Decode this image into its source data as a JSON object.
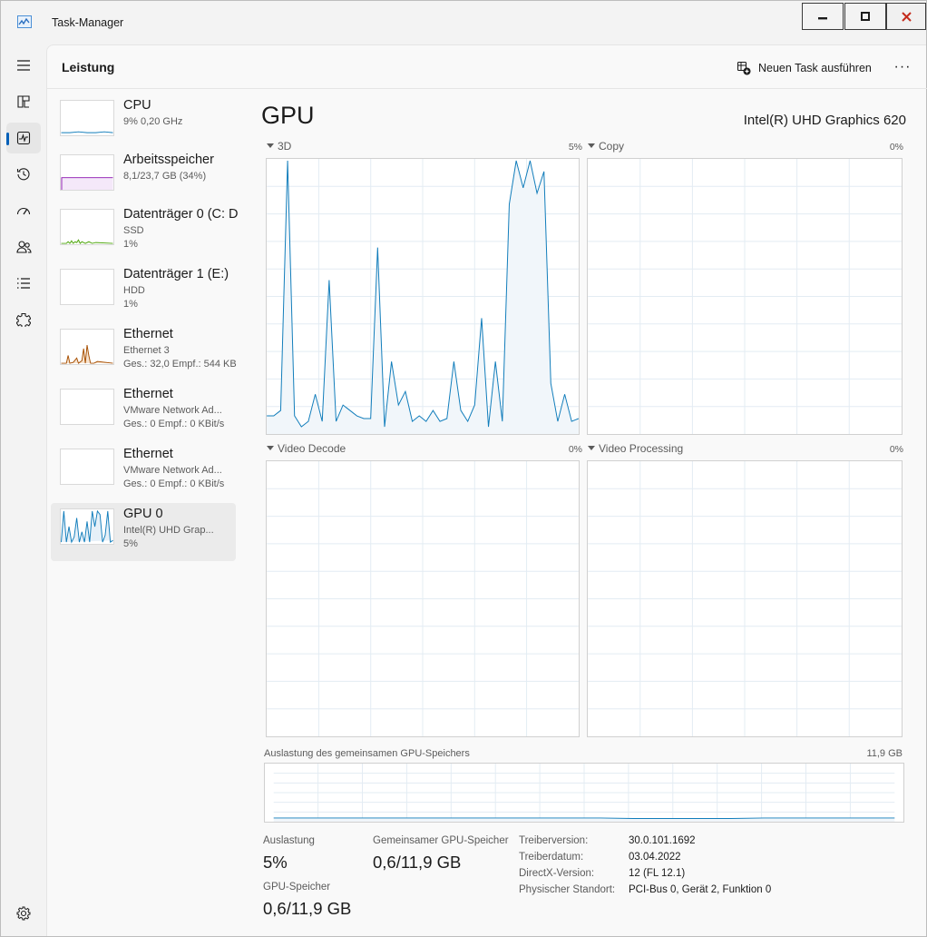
{
  "window": {
    "title": "Task-Manager"
  },
  "toolbar": {
    "page_title": "Leistung",
    "run_task_label": "Neuen Task ausführen",
    "more_label": "···"
  },
  "nav": {
    "items": [
      {
        "icon": "hamburger-menu-icon"
      },
      {
        "icon": "processes-icon"
      },
      {
        "icon": "performance-icon",
        "active": true
      },
      {
        "icon": "app-history-icon"
      },
      {
        "icon": "startup-apps-icon"
      },
      {
        "icon": "users-icon"
      },
      {
        "icon": "details-icon"
      },
      {
        "icon": "services-icon"
      }
    ],
    "settings_icon": "settings-gear-icon"
  },
  "resources": [
    {
      "name": "CPU",
      "line1": "9% 0,20 GHz",
      "line2": "",
      "color": "#117dbb"
    },
    {
      "name": "Arbeitsspeicher",
      "line1": "8,1/23,7 GB (34%)",
      "line2": "",
      "color": "#8b12ae"
    },
    {
      "name": "Datenträger 0 (C: D",
      "line1": "SSD",
      "line2": "1%",
      "color": "#4da60c"
    },
    {
      "name": "Datenträger 1 (E:)",
      "line1": "HDD",
      "line2": "1%",
      "color": "#4da60c"
    },
    {
      "name": "Ethernet",
      "line1": "Ethernet 3",
      "line2": "Ges.: 32,0 Empf.: 544 KB",
      "color": "#a74f01"
    },
    {
      "name": "Ethernet",
      "line1": "VMware Network Ad...",
      "line2": "Ges.: 0 Empf.: 0 KBit/s",
      "color": "#a74f01"
    },
    {
      "name": "Ethernet",
      "line1": "VMware Network Ad...",
      "line2": "Ges.: 0 Empf.: 0 KBit/s",
      "color": "#a74f01"
    },
    {
      "name": "GPU 0",
      "line1": "Intel(R) UHD Grap...",
      "line2": "5%",
      "color": "#117dbb",
      "selected": true
    }
  ],
  "detail": {
    "title": "GPU",
    "model": "Intel(R) UHD Graphics 620",
    "engines": [
      {
        "label": "3D",
        "percent": "5%"
      },
      {
        "label": "Copy",
        "percent": "0%"
      },
      {
        "label": "Video Decode",
        "percent": "0%"
      },
      {
        "label": "Video Processing",
        "percent": "0%"
      }
    ],
    "shared_memory_label": "Auslastung des gemeinsamen GPU-Speichers",
    "shared_memory_max": "11,9 GB",
    "stats": {
      "utilization_label": "Auslastung",
      "utilization_value": "5%",
      "shared_label": "Gemeinsamer GPU-Speicher",
      "shared_value": "0,6/11,9 GB",
      "gpu_memory_label": "GPU-Speicher",
      "gpu_memory_value": "0,6/11,9 GB"
    },
    "info": [
      {
        "key": "Treiberversion:",
        "value": "30.0.101.1692"
      },
      {
        "key": "Treiberdatum:",
        "value": "03.04.2022"
      },
      {
        "key": "DirectX-Version:",
        "value": "12 (FL 12.1)"
      },
      {
        "key": "Physischer Standort:",
        "value": "PCI-Bus 0, Gerät 2, Funktion 0"
      }
    ]
  },
  "chart_data": {
    "type": "line",
    "title": "3D",
    "ylim": [
      0,
      100
    ],
    "series": [
      {
        "values": [
          6,
          6,
          8,
          100,
          6,
          2,
          4,
          14,
          4,
          56,
          4,
          10,
          8,
          6,
          5,
          5,
          68,
          2,
          26,
          10,
          15,
          4,
          6,
          4,
          8,
          4,
          5,
          26,
          8,
          4,
          10,
          42,
          2,
          26,
          4,
          84,
          100,
          90,
          100,
          88,
          96,
          18,
          4,
          14,
          4,
          5
        ]
      }
    ],
    "shared_memory_series": {
      "values": [
        5,
        5,
        5,
        5,
        5,
        5,
        5,
        5,
        5,
        5,
        5,
        4,
        4,
        4,
        4,
        5,
        5,
        5,
        5,
        5
      ]
    },
    "colors": {
      "line": "#117dbb",
      "fill": "#f1f6fa",
      "grid": "#e3ecf3"
    }
  }
}
